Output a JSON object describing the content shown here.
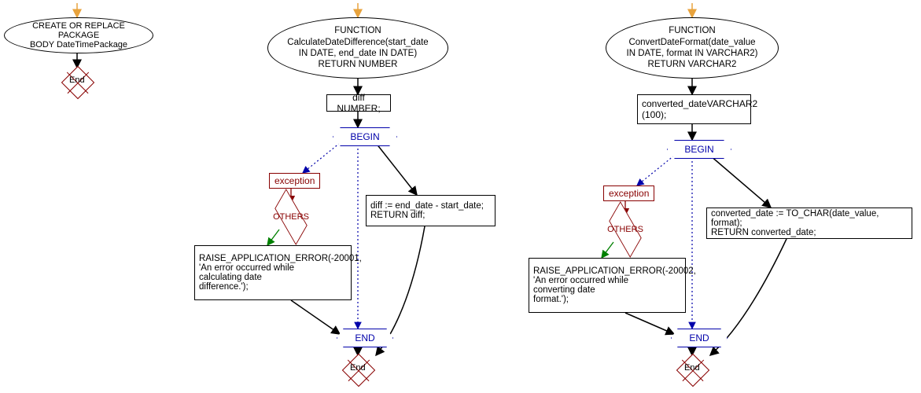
{
  "chart_data": [
    {
      "type": "flowchart",
      "title": "CREATE OR REPLACE PACKAGE BODY DateTimePackage",
      "nodes": [
        {
          "id": "pkg_head",
          "shape": "ellipse",
          "text": "CREATE OR REPLACE PACKAGE BODY DateTimePackage"
        },
        {
          "id": "pkg_end",
          "shape": "end",
          "text": "End"
        }
      ],
      "edges": [
        {
          "from": "entry",
          "to": "pkg_head",
          "style": "solid",
          "color": "orange"
        },
        {
          "from": "pkg_head",
          "to": "pkg_end",
          "style": "solid",
          "color": "black"
        }
      ]
    },
    {
      "type": "flowchart",
      "title": "FUNCTION CalculateDateDifference",
      "nodes": [
        {
          "id": "f1_head",
          "shape": "ellipse",
          "text": "FUNCTION CalculateDateDifference(start_date IN DATE, end_date IN DATE) RETURN NUMBER"
        },
        {
          "id": "f1_decl",
          "shape": "rect",
          "text": "diff NUMBER;"
        },
        {
          "id": "f1_begin",
          "shape": "hex",
          "text": "BEGIN"
        },
        {
          "id": "f1_exc",
          "shape": "exception",
          "text": "exception"
        },
        {
          "id": "f1_others",
          "shape": "diamond",
          "text": "OTHERS"
        },
        {
          "id": "f1_raise",
          "shape": "rect",
          "text": "RAISE_APPLICATION_ERROR(-20001, 'An error occurred while calculating date difference.');"
        },
        {
          "id": "f1_body",
          "shape": "rect",
          "text": "diff := end_date - start_date; RETURN diff;"
        },
        {
          "id": "f1_endhex",
          "shape": "hex",
          "text": "END"
        },
        {
          "id": "f1_end",
          "shape": "end",
          "text": "End"
        }
      ],
      "edges": [
        {
          "from": "entry",
          "to": "f1_head",
          "style": "solid",
          "color": "orange"
        },
        {
          "from": "f1_head",
          "to": "f1_decl",
          "style": "solid",
          "color": "black"
        },
        {
          "from": "f1_decl",
          "to": "f1_begin",
          "style": "solid",
          "color": "black"
        },
        {
          "from": "f1_begin",
          "to": "f1_exc",
          "style": "dotted",
          "color": "blue"
        },
        {
          "from": "f1_begin",
          "to": "f1_body",
          "style": "solid",
          "color": "black"
        },
        {
          "from": "f1_begin",
          "to": "f1_endhex",
          "style": "dotted",
          "color": "blue"
        },
        {
          "from": "f1_exc",
          "to": "f1_others",
          "style": "solid",
          "color": "darkred"
        },
        {
          "from": "f1_others",
          "to": "f1_raise",
          "style": "solid",
          "color": "green"
        },
        {
          "from": "f1_raise",
          "to": "f1_endhex",
          "style": "solid",
          "color": "black"
        },
        {
          "from": "f1_body",
          "to": "f1_end",
          "style": "solid",
          "color": "black"
        },
        {
          "from": "f1_endhex",
          "to": "f1_end",
          "style": "solid",
          "color": "black"
        }
      ]
    },
    {
      "type": "flowchart",
      "title": "FUNCTION ConvertDateFormat",
      "nodes": [
        {
          "id": "f2_head",
          "shape": "ellipse",
          "text": "FUNCTION ConvertDateFormat(date_value IN DATE, format IN VARCHAR2) RETURN VARCHAR2"
        },
        {
          "id": "f2_decl",
          "shape": "rect",
          "text": "converted_dateVARCHAR2(100);"
        },
        {
          "id": "f2_begin",
          "shape": "hex",
          "text": "BEGIN"
        },
        {
          "id": "f2_exc",
          "shape": "exception",
          "text": "exception"
        },
        {
          "id": "f2_others",
          "shape": "diamond",
          "text": "OTHERS"
        },
        {
          "id": "f2_raise",
          "shape": "rect",
          "text": "RAISE_APPLICATION_ERROR(-20002, 'An error occurred while converting date format.');"
        },
        {
          "id": "f2_body",
          "shape": "rect",
          "text": "converted_date := TO_CHAR(date_value, format); RETURN converted_date;"
        },
        {
          "id": "f2_endhex",
          "shape": "hex",
          "text": "END"
        },
        {
          "id": "f2_end",
          "shape": "end",
          "text": "End"
        }
      ],
      "edges": [
        {
          "from": "entry",
          "to": "f2_head",
          "style": "solid",
          "color": "orange"
        },
        {
          "from": "f2_head",
          "to": "f2_decl",
          "style": "solid",
          "color": "black"
        },
        {
          "from": "f2_decl",
          "to": "f2_begin",
          "style": "solid",
          "color": "black"
        },
        {
          "from": "f2_begin",
          "to": "f2_exc",
          "style": "dotted",
          "color": "blue"
        },
        {
          "from": "f2_begin",
          "to": "f2_body",
          "style": "solid",
          "color": "black"
        },
        {
          "from": "f2_begin",
          "to": "f2_endhex",
          "style": "dotted",
          "color": "blue"
        },
        {
          "from": "f2_exc",
          "to": "f2_others",
          "style": "solid",
          "color": "darkred"
        },
        {
          "from": "f2_others",
          "to": "f2_raise",
          "style": "solid",
          "color": "green"
        },
        {
          "from": "f2_raise",
          "to": "f2_endhex",
          "style": "solid",
          "color": "black"
        },
        {
          "from": "f2_body",
          "to": "f2_end",
          "style": "solid",
          "color": "black"
        },
        {
          "from": "f2_endhex",
          "to": "f2_end",
          "style": "solid",
          "color": "black"
        }
      ]
    }
  ],
  "labels": {
    "pkg_head": "CREATE OR REPLACE PACKAGE\nBODY DateTimePackage",
    "end": "End",
    "f1_head": "FUNCTION\nCalculateDateDifference(start_date\nIN DATE, end_date IN DATE)\nRETURN NUMBER",
    "f1_decl": "diff NUMBER;",
    "begin": "BEGIN",
    "exception": "exception",
    "others": "OTHERS",
    "f1_raise": "RAISE_APPLICATION_ERROR(-20001,\n'An error occurred while\ncalculating date\ndifference.');",
    "f1_body": "diff := end_date - start_date;\nRETURN diff;",
    "endhex": "END",
    "f2_head": "FUNCTION\nConvertDateFormat(date_value\nIN DATE, format IN VARCHAR2)\nRETURN VARCHAR2",
    "f2_decl": "converted_dateVARCHAR2\n(100);",
    "f2_raise": "RAISE_APPLICATION_ERROR(-20002,\n'An error occurred while\nconverting date\nformat.');",
    "f2_body": "converted_date := TO_CHAR(date_value, format);\nRETURN converted_date;"
  }
}
